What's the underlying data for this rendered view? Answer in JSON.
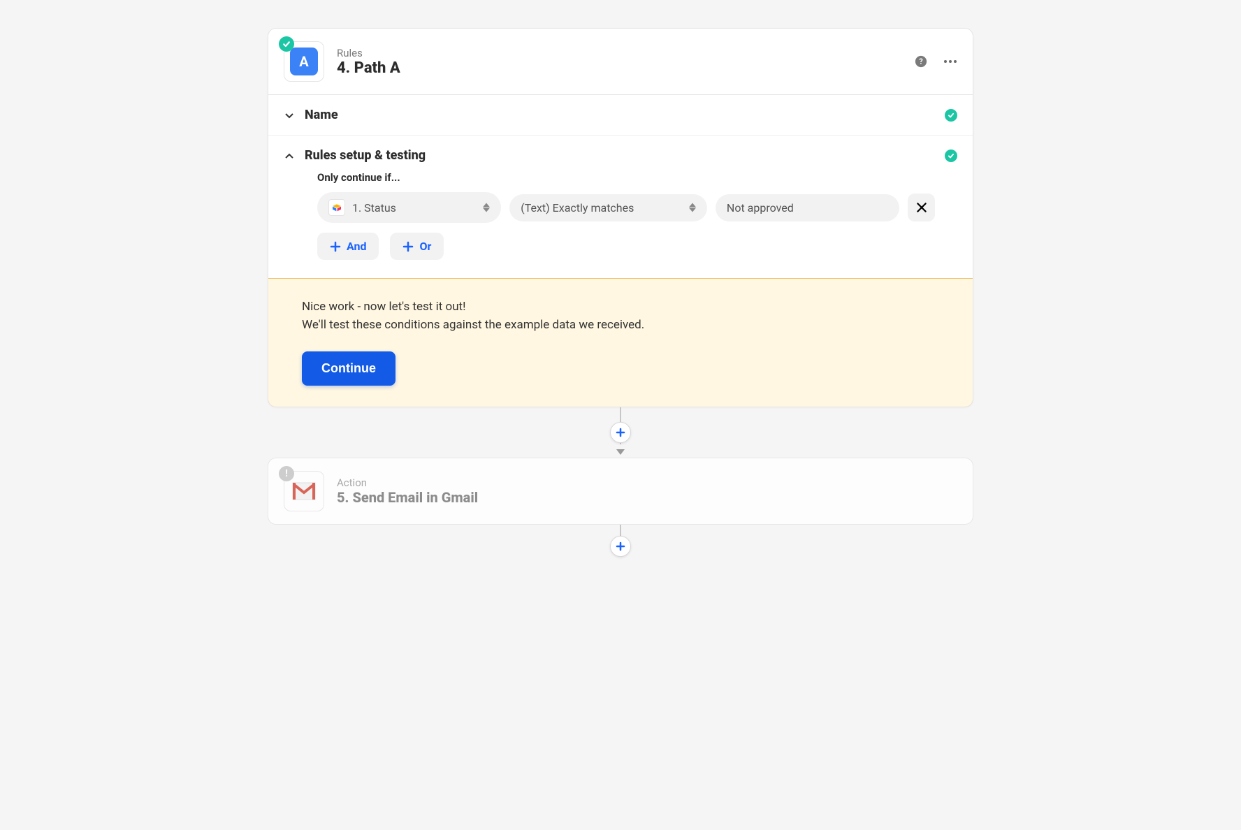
{
  "step": {
    "kicker": "Rules",
    "title": "4. Path A",
    "iconLetter": "A"
  },
  "sections": {
    "name": {
      "title": "Name"
    },
    "rules": {
      "title": "Rules setup & testing",
      "label": "Only continue if...",
      "condition": {
        "field": "1. Status",
        "operator": "(Text) Exactly matches",
        "value": "Not approved"
      },
      "andLabel": "And",
      "orLabel": "Or"
    }
  },
  "test": {
    "line1": "Nice work - now let's test it out!",
    "line2": "We'll test these conditions against the example data we received.",
    "button": "Continue"
  },
  "nextStep": {
    "kicker": "Action",
    "title": "5. Send Email in Gmail"
  }
}
